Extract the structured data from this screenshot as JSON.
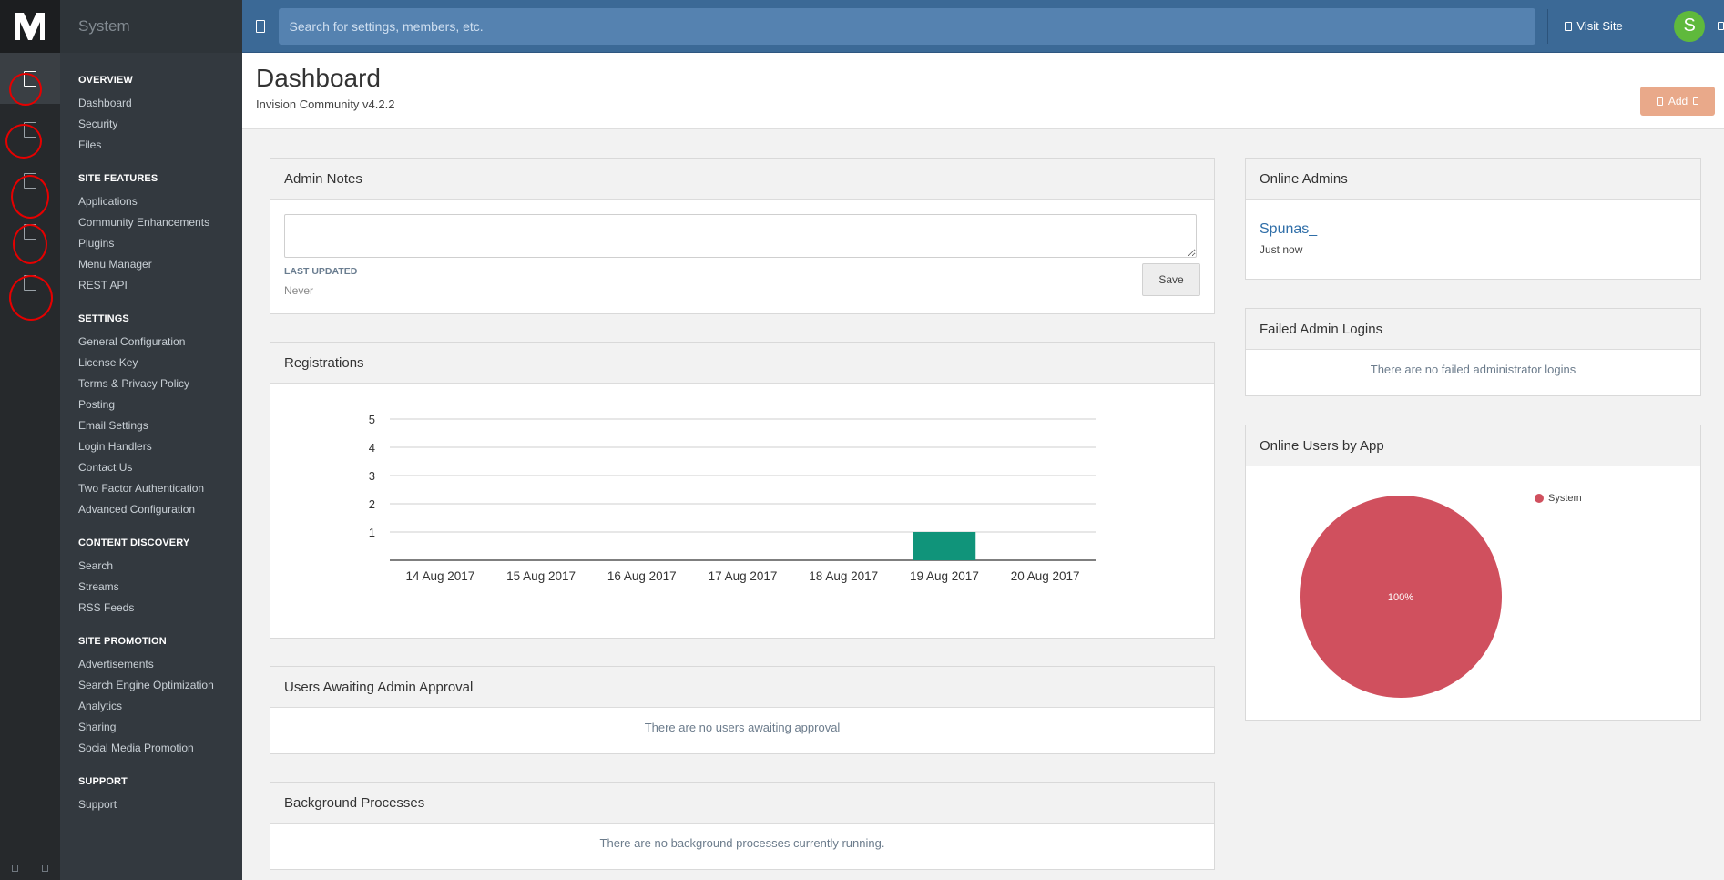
{
  "app": {
    "section_title": "System"
  },
  "nav": {
    "groups": [
      {
        "title": "OVERVIEW",
        "items": [
          "Dashboard",
          "Security",
          "Files"
        ]
      },
      {
        "title": "SITE FEATURES",
        "items": [
          "Applications",
          "Community Enhancements",
          "Plugins",
          "Menu Manager",
          "REST API"
        ]
      },
      {
        "title": "SETTINGS",
        "items": [
          "General Configuration",
          "License Key",
          "Terms & Privacy Policy",
          "Posting",
          "Email Settings",
          "Login Handlers",
          "Contact Us",
          "Two Factor Authentication",
          "Advanced Configuration"
        ]
      },
      {
        "title": "CONTENT DISCOVERY",
        "items": [
          "Search",
          "Streams",
          "RSS Feeds"
        ]
      },
      {
        "title": "SITE PROMOTION",
        "items": [
          "Advertisements",
          "Search Engine Optimization",
          "Analytics",
          "Sharing",
          "Social Media Promotion"
        ]
      },
      {
        "title": "SUPPORT",
        "items": [
          "Support"
        ]
      }
    ]
  },
  "topbar": {
    "search_placeholder": "Search for settings, members, etc.",
    "visit_site": "Visit Site",
    "avatar_initial": "S"
  },
  "header": {
    "title": "Dashboard",
    "subtitle": "Invision Community v4.2.2",
    "add_label": "Add"
  },
  "admin_notes": {
    "title": "Admin Notes",
    "last_updated_label": "LAST UPDATED",
    "last_updated_value": "Never",
    "save_label": "Save"
  },
  "registrations": {
    "title": "Registrations"
  },
  "awaiting": {
    "title": "Users Awaiting Admin Approval",
    "empty": "There are no users awaiting approval"
  },
  "background": {
    "title": "Background Processes",
    "empty": "There are no background processes currently running."
  },
  "online_admins": {
    "title": "Online Admins",
    "name": "Spunas_",
    "time": "Just now"
  },
  "failed_logins": {
    "title": "Failed Admin Logins",
    "empty": "There are no failed administrator logins"
  },
  "online_users": {
    "title": "Online Users by App"
  },
  "colors": {
    "bar": "#10947a",
    "pie": "#d0505e",
    "accent": "#3b6996"
  },
  "chart_data": [
    {
      "type": "bar",
      "categories": [
        "14 Aug 2017",
        "15 Aug 2017",
        "16 Aug 2017",
        "17 Aug 2017",
        "18 Aug 2017",
        "19 Aug 2017",
        "20 Aug 2017"
      ],
      "values": [
        0,
        0,
        0,
        0,
        0,
        1,
        0
      ],
      "yticks": [
        1,
        2,
        3,
        4,
        5
      ],
      "ylim": [
        0,
        5
      ],
      "grid": true
    },
    {
      "type": "pie",
      "labels": [
        "System"
      ],
      "values": [
        100
      ],
      "slice_labels": [
        "100%"
      ],
      "legend": "top-right"
    }
  ]
}
